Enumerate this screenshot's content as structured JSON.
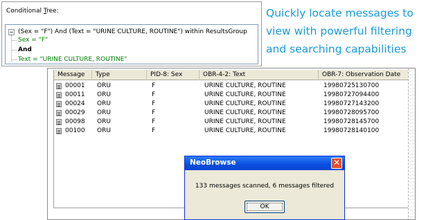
{
  "tree": {
    "title_prefix": "Conditional ",
    "title_accel": "T",
    "title_suffix": "ree:",
    "expander": "−",
    "root": "(Sex = \"F\") And (Text = \"URINE CULTURE, ROUTINE\") within ResultsGroup",
    "child1": "Sex = \"F\"",
    "child2": "And",
    "child3": "Text = \"URINE CULTURE, ROUTINE\""
  },
  "marketing": {
    "line1": "Quickly locate messages to",
    "line2": "view with powerful filtering",
    "line3": "and searching capabilities"
  },
  "table": {
    "columns": [
      "Message",
      "Type",
      "PID-8: Sex",
      "OBR-4-2: Text",
      "OBR-7: Observation Date"
    ],
    "rows": [
      [
        "00001",
        "ORU",
        "F",
        "URINE CULTURE, ROUTINE",
        "19980725130700"
      ],
      [
        "00011",
        "ORU",
        "F",
        "URINE CULTURE, ROUTINE",
        "19980727094400"
      ],
      [
        "00024",
        "ORU",
        "F",
        "URINE CULTURE, ROUTINE",
        "19980727143200"
      ],
      [
        "00029",
        "ORU",
        "F",
        "URINE CULTURE, ROUTINE",
        "19980728095700"
      ],
      [
        "00098",
        "ORU",
        "F",
        "URINE CULTURE, ROUTINE",
        "19980728145700"
      ],
      [
        "00100",
        "ORU",
        "F",
        "URINE CULTURE, ROUTINE",
        "19980728140100"
      ]
    ]
  },
  "dialog": {
    "title": "NeoBrowse",
    "close": "✕",
    "message": "133 messages scanned,  6 messages filtered",
    "ok": "OK"
  },
  "colors": {
    "accent_text": "#1a9bd7",
    "tree_green": "#008000",
    "titlebar": "#0a4ee0"
  }
}
